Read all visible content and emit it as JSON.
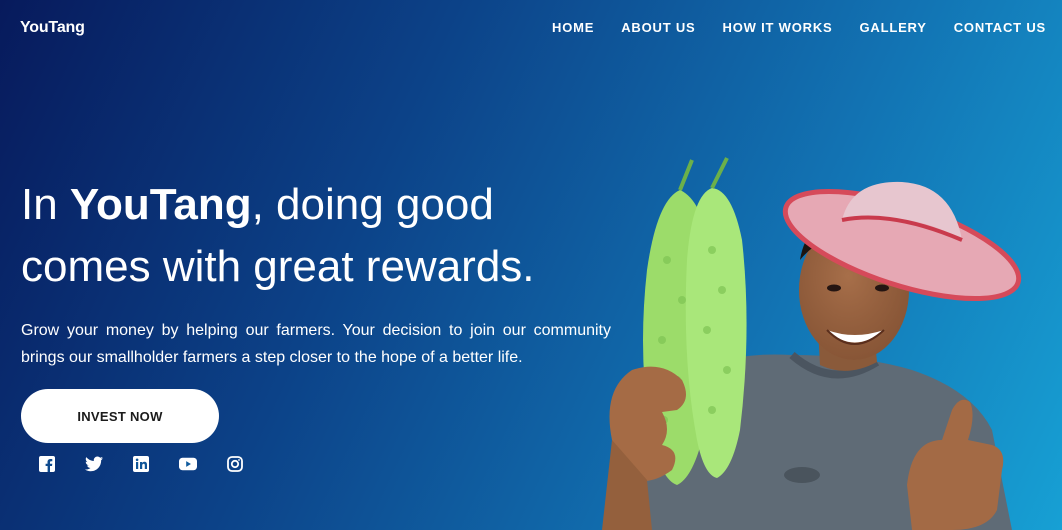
{
  "nav": {
    "logo": "YouTang",
    "items": [
      {
        "label": "HOME"
      },
      {
        "label": "ABOUT US"
      },
      {
        "label": "HOW IT WORKS"
      },
      {
        "label": "GALLERY"
      },
      {
        "label": "CONTACT US"
      }
    ]
  },
  "hero": {
    "title_pre": "In ",
    "title_brand": "YouTang",
    "title_post": ", doing good comes with great rewards.",
    "description": "Grow your money by helping our farmers. Your decision to join our community brings our smallholder farmers a step closer to the hope of a better life.",
    "cta_label": "INVEST NOW"
  },
  "socials": {
    "icons": [
      "facebook-icon",
      "twitter-icon",
      "linkedin-icon",
      "youtube-icon",
      "instagram-icon"
    ]
  },
  "colors": {
    "bg_start": "#071a5c",
    "bg_end": "#17a0d4",
    "button_bg": "#ffffff",
    "button_text": "#1b1b1b"
  }
}
